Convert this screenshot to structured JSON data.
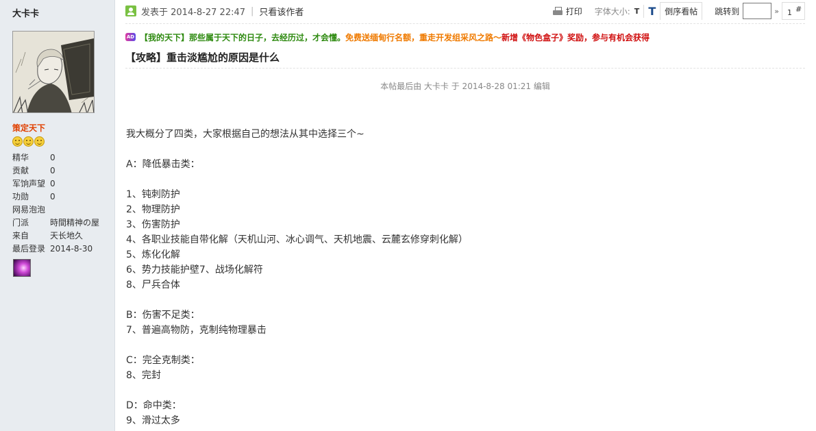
{
  "user": {
    "name": "大卡卡",
    "rank": "策定天下",
    "stats": [
      {
        "label": "精华",
        "value": "0"
      },
      {
        "label": "贡献",
        "value": "0"
      },
      {
        "label": "军饷声望",
        "value": "0"
      },
      {
        "label": "功勋",
        "value": "0"
      },
      {
        "label": "网易泡泡",
        "value": ""
      },
      {
        "label": "门派",
        "value": "時間精神の屋"
      },
      {
        "label": "来自",
        "value": "天长地久"
      },
      {
        "label": "最后登录",
        "value": "2014-8-30"
      }
    ]
  },
  "post": {
    "posted_prefix": "发表于 2014-8-27 22:47",
    "separator": "|",
    "author_only": "只看该作者",
    "ad_icon": "AD",
    "ad_green": "【我的天下】那些属于天下的日子，去经历过，才会懂。",
    "ad_orange": "免费送缅甸行名额，重走开发组采风之路～",
    "ad_red": "新增《物色盒子》奖励，参与有机会获得",
    "title": "【攻略】重击淡尴尬的原因是什么",
    "edit_note": "本帖最后由 大卡卡 于 2014-8-28 01:21 编辑",
    "lines": [
      "我大概分了四类，大家根据自己的想法从其中选择三个~",
      "",
      "A：降低暴击类：",
      "",
      "1、钝刺防护",
      "2、物理防护",
      "3、伤害防护",
      "4、各职业技能自带化解（天机山河、冰心调气、天机地震、云麓玄修穿刺化解）",
      "5、炼化化解",
      "6、势力技能护壁7、战场化解符",
      "8、尸兵合体",
      "",
      "B：伤害不足类：",
      "7、普遍高物防，克制纯物理暴击",
      "",
      "C：完全克制类：",
      "8、完封",
      "",
      "D：命中类：",
      "9、滑过太多"
    ]
  },
  "toolbar": {
    "print": "打印",
    "font_size_label": "字体大小:",
    "font_small": "T",
    "font_large": "T",
    "reverse": "倒序看帖",
    "jump_label": "跳转到",
    "jump_arrow": "»",
    "floor_number": "1",
    "floor_hash": "#"
  },
  "icons": {
    "online": "user-online-icon",
    "print": "printer-icon",
    "ad": "ad-badge-icon",
    "smiley": "smiley-icon",
    "medal": "medal-icon"
  },
  "colors": {
    "sidebar_bg": "#e8ecf0",
    "rank": "#e04000",
    "ad_green": "#2e8a10",
    "ad_orange": "#ef7a00",
    "ad_red": "#d01010"
  }
}
